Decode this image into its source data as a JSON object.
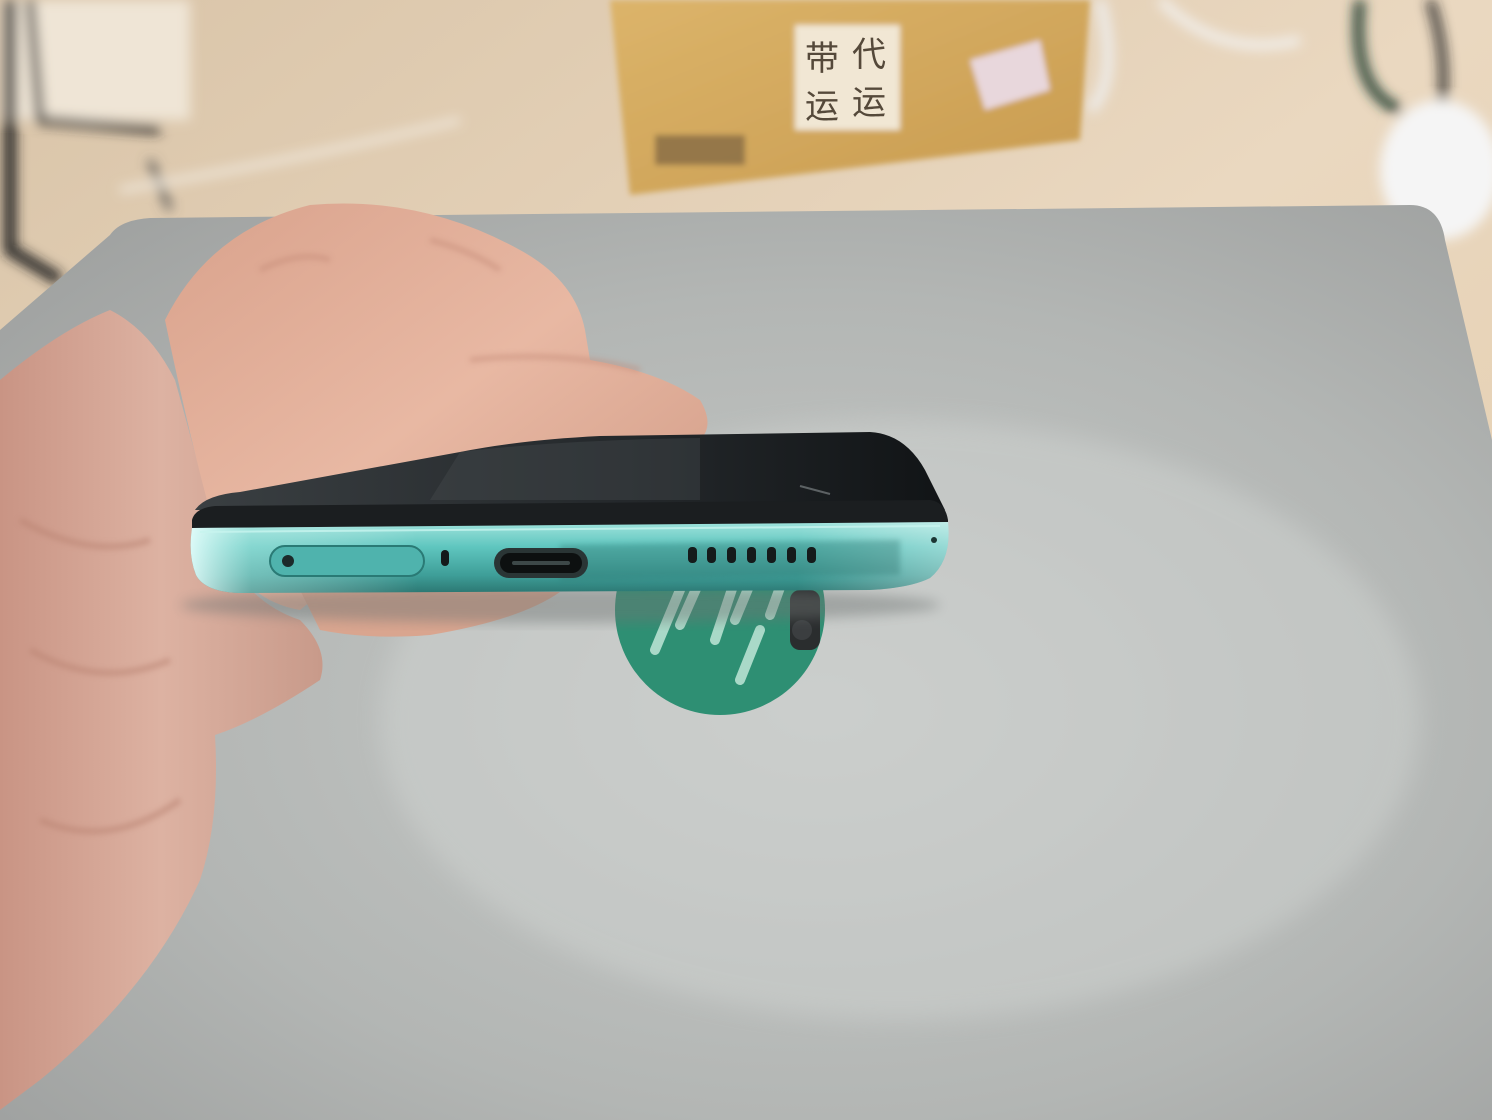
{
  "scene": {
    "palette": {
      "desk": "#e6d2b8",
      "laptop_lid": "#b5b8b7",
      "laptop_logo": "#2e8f73",
      "box": "#d1a85e",
      "phone_frame": "#58c2bc",
      "phone_glass": "#1f2326",
      "skin": "#dba892",
      "sleeve": "#d7a797"
    },
    "box_label": {
      "row1_left": "带",
      "row1_right": "代",
      "row2_left": "运",
      "row2_right": "运"
    },
    "icons": [
      "sim-tray-icon",
      "microphone-hole-icon",
      "usb-c-port-icon",
      "speaker-grille-icon",
      "hp-logo-icon"
    ]
  }
}
